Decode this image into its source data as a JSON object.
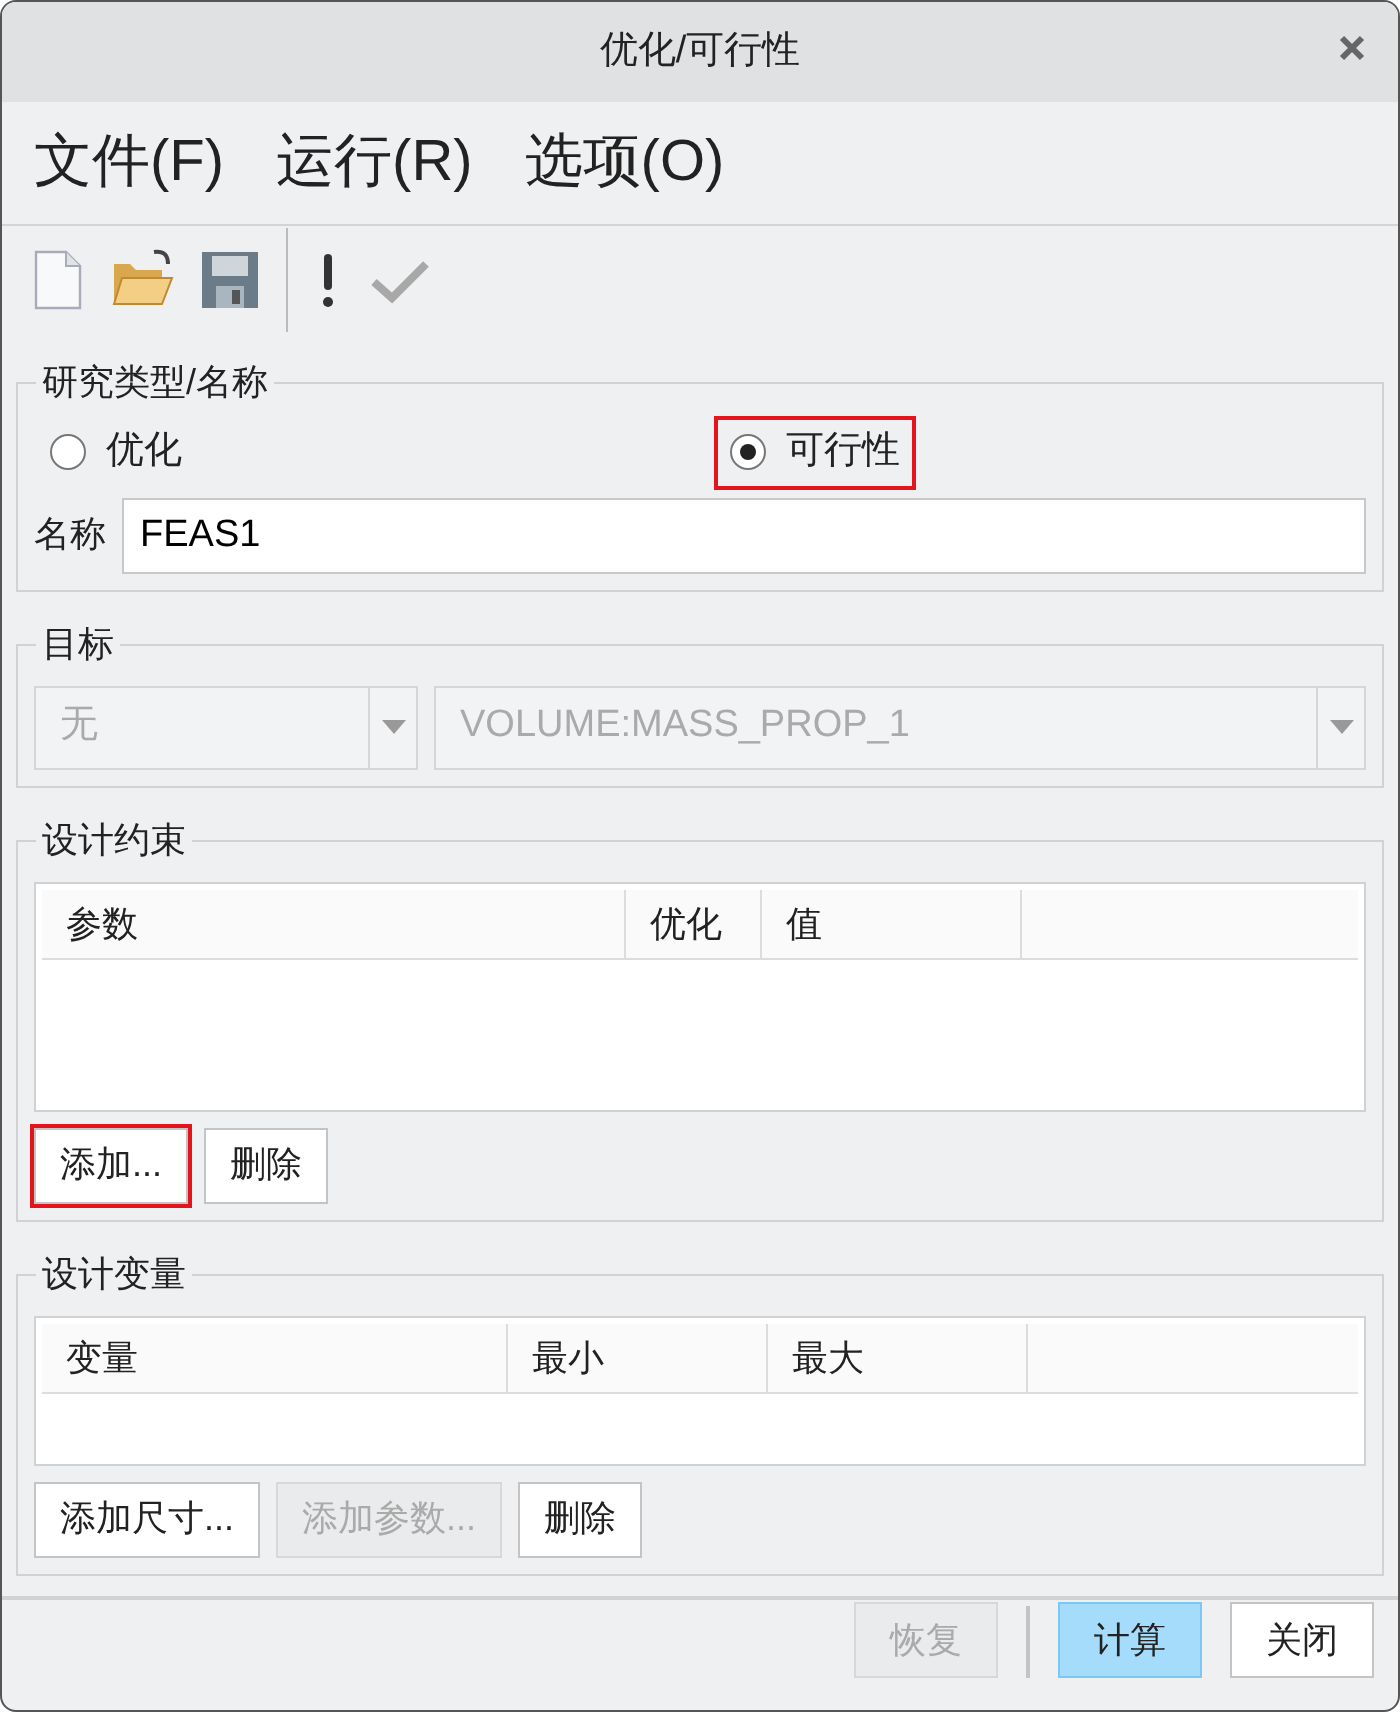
{
  "window": {
    "title": "优化/可行性"
  },
  "menu": [
    {
      "label": "文件(F)"
    },
    {
      "label": "运行(R)"
    },
    {
      "label": "选项(O)"
    }
  ],
  "toolbar": {
    "apply_disabled": true
  },
  "study": {
    "title": "研究类型/名称",
    "options": [
      {
        "label": "优化",
        "selected": false,
        "highlighted": false
      },
      {
        "label": "可行性",
        "selected": true,
        "highlighted": true
      }
    ],
    "name_label": "名称",
    "name_value": "FEAS1"
  },
  "goal": {
    "title": "目标",
    "dropdowns": [
      {
        "value": "无",
        "disabled": true
      },
      {
        "value": "VOLUME:MASS_PROP_1",
        "disabled": true
      }
    ]
  },
  "constraints": {
    "title": "设计约束",
    "columns": [
      "参数",
      "优化",
      "值"
    ],
    "buttons": [
      {
        "label": "添加...",
        "disabled": false,
        "highlighted": true
      },
      {
        "label": "删除",
        "disabled": false,
        "highlighted": false
      }
    ]
  },
  "variables": {
    "title": "设计变量",
    "columns": [
      "变量",
      "最小",
      "最大"
    ],
    "buttons": [
      {
        "label": "添加尺寸...",
        "disabled": false,
        "highlighted": false
      },
      {
        "label": "添加参数...",
        "disabled": true,
        "highlighted": false
      },
      {
        "label": "删除",
        "disabled": false,
        "highlighted": false
      }
    ]
  },
  "footer": {
    "buttons": [
      {
        "label": "恢复",
        "disabled": true,
        "primary": false
      },
      {
        "label": "计算",
        "disabled": false,
        "primary": true
      },
      {
        "label": "关闭",
        "disabled": false,
        "primary": false
      }
    ]
  }
}
